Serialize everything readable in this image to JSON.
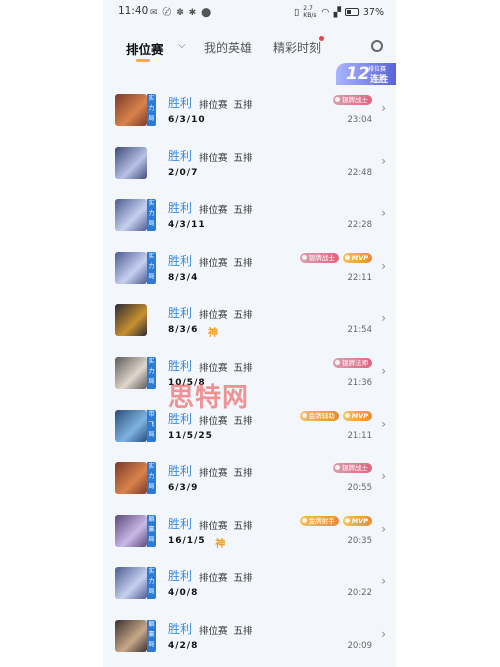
{
  "status_bar": {
    "time": "11:40",
    "left_icons": "✉ 〄 ✽ ✱ ⬤",
    "net_speed": "2.7 KB/s",
    "battery_percent": "37%",
    "icons": [
      "vibrate-icon",
      "wifi-icon",
      "signal-icon",
      "battery-icon"
    ]
  },
  "header": {
    "tabs": [
      {
        "label": "排位赛",
        "active": true
      },
      {
        "label": "我的英雄",
        "active": false
      },
      {
        "label": "精彩时刻",
        "active": false
      }
    ],
    "streak": {
      "number": "12",
      "small_label": "排位赛",
      "word": "连胜"
    }
  },
  "matches": [
    {
      "result": "胜利",
      "mode": "排位赛  五排",
      "kda": "6/3/10",
      "tag": "实力局",
      "badges": [
        {
          "text": "银牌战士",
          "type": "silver"
        }
      ],
      "time": "23:04",
      "god": ""
    },
    {
      "result": "胜利",
      "mode": "排位赛  五排",
      "kda": "2/0/7",
      "tag": "",
      "badges": [],
      "time": "22:48",
      "god": ""
    },
    {
      "result": "胜利",
      "mode": "排位赛  五排",
      "kda": "4/3/11",
      "tag": "实力局",
      "badges": [],
      "time": "22:28",
      "god": ""
    },
    {
      "result": "胜利",
      "mode": "排位赛  五排",
      "kda": "8/3/4",
      "tag": "实力局",
      "badges": [
        {
          "text": "银牌战士",
          "type": "silver"
        },
        {
          "text": "MVP",
          "type": "mvp"
        }
      ],
      "time": "22:11",
      "god": ""
    },
    {
      "result": "胜利",
      "mode": "排位赛  五排",
      "kda": "8/3/6",
      "tag": "",
      "badges": [],
      "time": "21:54",
      "god": "神"
    },
    {
      "result": "胜利",
      "mode": "排位赛  五排",
      "kda": "10/5/8",
      "tag": "实力局",
      "badges": [
        {
          "text": "银牌法师",
          "type": "silver"
        }
      ],
      "time": "21:36",
      "god": ""
    },
    {
      "result": "胜利",
      "mode": "排位赛  五排",
      "kda": "11/5/25",
      "tag": "带飞局",
      "badges": [
        {
          "text": "金牌辅助",
          "type": "gold"
        },
        {
          "text": "MVP",
          "type": "mvp"
        }
      ],
      "time": "21:11",
      "god": ""
    },
    {
      "result": "胜利",
      "mode": "排位赛  五排",
      "kda": "6/3/9",
      "tag": "实力局",
      "badges": [
        {
          "text": "银牌战士",
          "type": "silver"
        }
      ],
      "time": "20:55",
      "god": ""
    },
    {
      "result": "胜利",
      "mode": "排位赛  五排",
      "kda": "16/1/5",
      "tag": "躺赢局",
      "badges": [
        {
          "text": "金牌射手",
          "type": "gold"
        },
        {
          "text": "MVP",
          "type": "mvp"
        }
      ],
      "time": "20:35",
      "god": "神"
    },
    {
      "result": "胜利",
      "mode": "排位赛  五排",
      "kda": "4/0/8",
      "tag": "实力局",
      "badges": [],
      "time": "20:22",
      "god": ""
    },
    {
      "result": "胜利",
      "mode": "排位赛  五排",
      "kda": "4/2/8",
      "tag": "躺赢局",
      "badges": [],
      "time": "20:09",
      "god": ""
    }
  ],
  "watermark": "思特网",
  "colors": {
    "accent_win": "#3a8ce0",
    "tab_underline": "#f0b429",
    "tag_blue": "#2b7bd6",
    "god_gold": "#f0a020"
  }
}
